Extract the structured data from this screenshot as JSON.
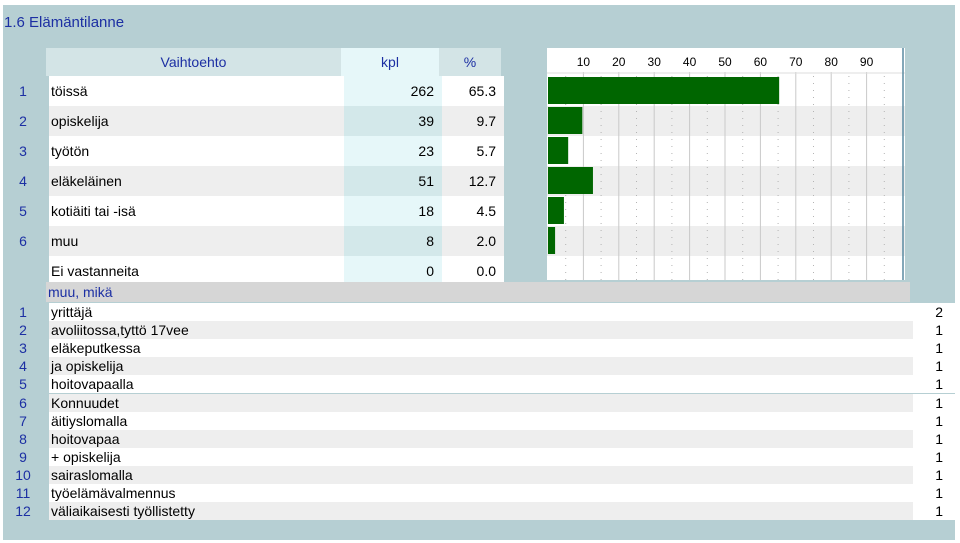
{
  "title": "1.6 Elämäntilanne",
  "table_header": {
    "option": "Vaihtoehto",
    "count": "kpl",
    "percent": "%"
  },
  "rows": [
    {
      "num": "1",
      "label": "töissä",
      "kpl": "262",
      "pct": "65.3"
    },
    {
      "num": "2",
      "label": "opiskelija",
      "kpl": "39",
      "pct": "9.7"
    },
    {
      "num": "3",
      "label": "työtön",
      "kpl": "23",
      "pct": "5.7"
    },
    {
      "num": "4",
      "label": "eläkeläinen",
      "kpl": "51",
      "pct": "12.7"
    },
    {
      "num": "5",
      "label": "kotiäiti tai -isä",
      "kpl": "18",
      "pct": "4.5"
    },
    {
      "num": "6",
      "label": "muu",
      "kpl": "8",
      "pct": "2.0"
    },
    {
      "num": "",
      "label": "Ei vastanneita",
      "kpl": "0",
      "pct": "0.0"
    }
  ],
  "chart_data": {
    "type": "bar",
    "orientation": "horizontal",
    "categories": [
      "töissä",
      "opiskelija",
      "työtön",
      "eläkeläinen",
      "kotiäiti tai -isä",
      "muu",
      "Ei vastanneita"
    ],
    "values": [
      65.3,
      9.7,
      5.7,
      12.7,
      4.5,
      2.0,
      0.0
    ],
    "ticks": [
      "10",
      "20",
      "30",
      "40",
      "50",
      "60",
      "70",
      "80",
      "90"
    ],
    "xlim": [
      0,
      100
    ],
    "bar_color": "#006600",
    "grid": true
  },
  "other_section": {
    "header": "muu, mikä",
    "items": [
      {
        "num": "1",
        "label": "yrittäjä",
        "count": "2"
      },
      {
        "num": "2",
        "label": "avoliitossa,tyttö 17vee",
        "count": "1"
      },
      {
        "num": "3",
        "label": "eläkeputkessa",
        "count": "1"
      },
      {
        "num": "4",
        "label": "ja opiskelija",
        "count": "1"
      },
      {
        "num": "5",
        "label": "hoitovapaalla",
        "count": "1"
      },
      {
        "num": "6",
        "label": "Konnuudet",
        "count": "1"
      },
      {
        "num": "7",
        "label": "äitiyslomalla",
        "count": "1"
      },
      {
        "num": "8",
        "label": "hoitovapaa",
        "count": "1"
      },
      {
        "num": "9",
        "label": "+ opiskelija",
        "count": "1"
      },
      {
        "num": "10",
        "label": "sairaslomalla",
        "count": "1"
      },
      {
        "num": "11",
        "label": "työelämävalmennus",
        "count": "1"
      },
      {
        "num": "12",
        "label": "väliaikaisesti työllistetty",
        "count": "1"
      }
    ]
  },
  "colors": {
    "accent_text": "#1c2fa3",
    "frame": "#b6cfd3",
    "bar": "#006600"
  }
}
